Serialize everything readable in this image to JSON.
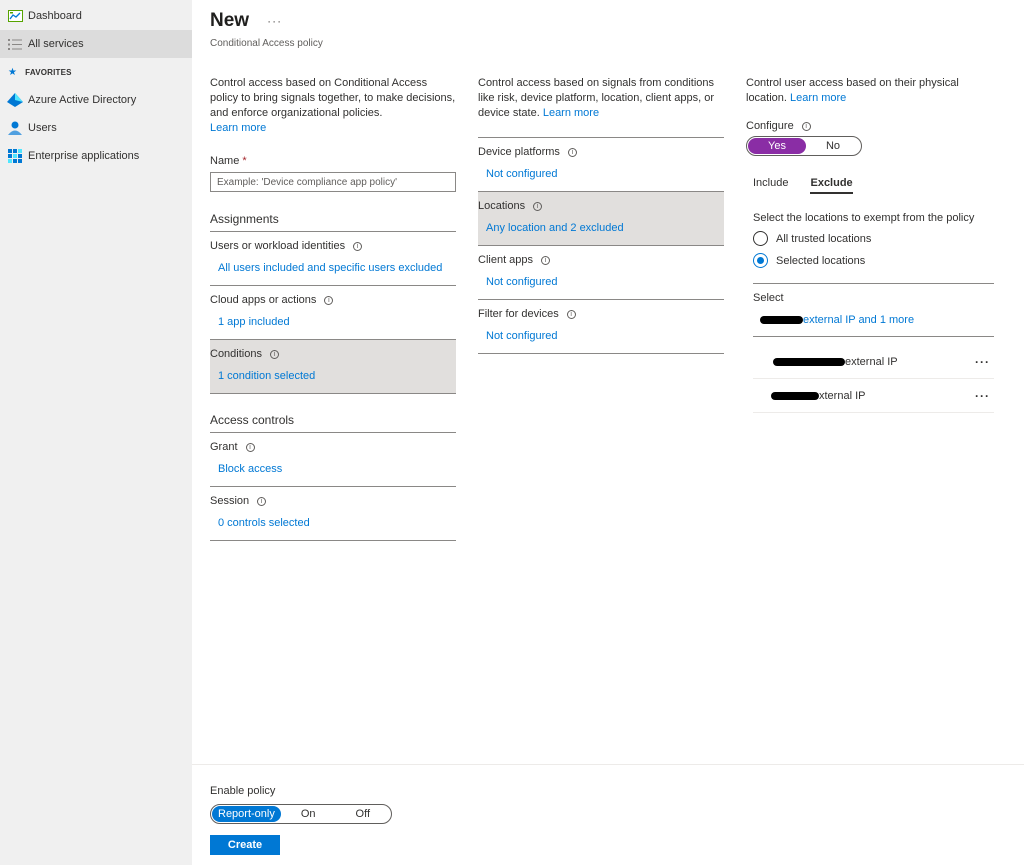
{
  "sidebar": {
    "items": [
      {
        "label": "Dashboard",
        "icon": "dashboard-icon"
      },
      {
        "label": "All services",
        "icon": "list-icon"
      }
    ],
    "favorites_label": "FAVORITES",
    "favorites": [
      {
        "label": "Azure Active Directory",
        "icon": "aad-icon"
      },
      {
        "label": "Users",
        "icon": "user-icon"
      },
      {
        "label": "Enterprise applications",
        "icon": "apps-grid-icon"
      }
    ]
  },
  "header": {
    "title": "New",
    "more": "···",
    "subtitle": "Conditional Access policy"
  },
  "left": {
    "description": "Control access based on Conditional Access policy to bring signals together, to make decisions, and enforce organizational policies.",
    "learn_more": "Learn more",
    "name_label": "Name",
    "name_required": "*",
    "name_placeholder": "Example: 'Device compliance app policy'",
    "assignments_title": "Assignments",
    "assignments": [
      {
        "label": "Users or workload identities",
        "value": "All users included and specific users excluded"
      },
      {
        "label": "Cloud apps or actions",
        "value": "1 app included"
      },
      {
        "label": "Conditions",
        "value": "1 condition selected"
      }
    ],
    "access_title": "Access controls",
    "access": [
      {
        "label": "Grant",
        "value": "Block access"
      },
      {
        "label": "Session",
        "value": "0 controls selected"
      }
    ]
  },
  "middle": {
    "description": "Control access based on signals from conditions like risk, device platform, location, client apps, or device state.",
    "learn_more": "Learn more",
    "rows": [
      {
        "label": "Device platforms",
        "value": "Not configured"
      },
      {
        "label": "Locations",
        "value": "Any location and 2 excluded"
      },
      {
        "label": "Client apps",
        "value": "Not configured"
      },
      {
        "label": "Filter for devices",
        "value": "Not configured"
      }
    ]
  },
  "right": {
    "description": "Control user access based on their physical location.",
    "learn_more": "Learn more",
    "configure_label": "Configure",
    "configure_yes": "Yes",
    "configure_no": "No",
    "tabs": [
      "Include",
      "Exclude"
    ],
    "exempt_text": "Select the locations to exempt from the policy",
    "radio_all": "All trusted locations",
    "radio_selected": "Selected locations",
    "select_label": "Select",
    "select_value": "external IP and 1 more",
    "locations": [
      "external IP",
      "xternal IP"
    ],
    "more": "···"
  },
  "footer": {
    "enable_label": "Enable policy",
    "options": [
      "Report-only",
      "On",
      "Off"
    ],
    "create_label": "Create"
  }
}
